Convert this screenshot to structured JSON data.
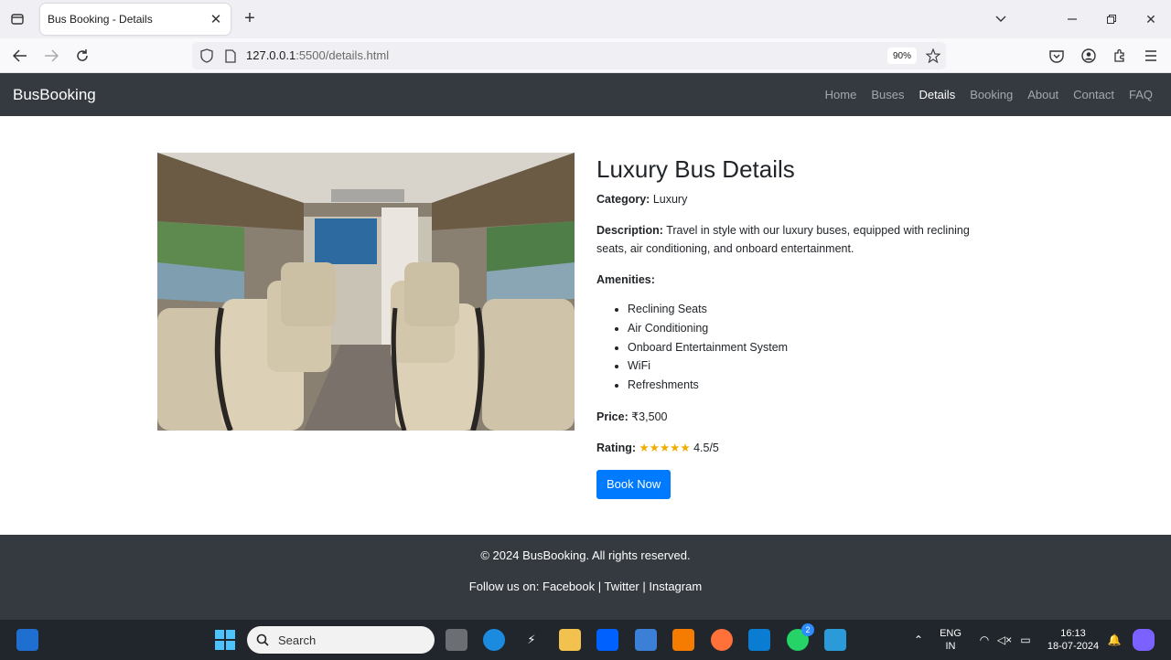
{
  "browser": {
    "tab_title": "Bus Booking - Details",
    "url_host": "127.0.0.1",
    "url_rest": ":5500/details.html",
    "zoom": "90%"
  },
  "site": {
    "brand": "BusBooking",
    "nav": [
      "Home",
      "Buses",
      "Details",
      "Booking",
      "About",
      "Contact",
      "FAQ"
    ],
    "active_nav": "Details"
  },
  "details": {
    "title": "Luxury Bus Details",
    "category_label": "Category:",
    "category": "Luxury",
    "description_label": "Description:",
    "description": "Travel in style with our luxury buses, equipped with reclining seats, air conditioning, and onboard entertainment.",
    "amenities_label": "Amenities:",
    "amenities": [
      "Reclining Seats",
      "Air Conditioning",
      "Onboard Entertainment System",
      "WiFi",
      "Refreshments"
    ],
    "price_label": "Price:",
    "price": "₹3,500",
    "rating_label": "Rating:",
    "rating_stars": "★★★★★",
    "rating": "4.5/5",
    "book_button": "Book Now"
  },
  "footer": {
    "copyright": "© 2024 BusBooking. All rights reserved.",
    "follow_prefix": "Follow us on: ",
    "links": [
      "Facebook",
      "Twitter",
      "Instagram"
    ],
    "separator": " | "
  },
  "taskbar": {
    "search_placeholder": "Search",
    "lang_top": "ENG",
    "lang_bottom": "IN",
    "time": "16:13",
    "date": "18-07-2024",
    "whatsapp_badge": "2"
  },
  "colors": {
    "navbar_bg": "#343a40",
    "primary": "#007bff",
    "star": "#f0ad00"
  }
}
